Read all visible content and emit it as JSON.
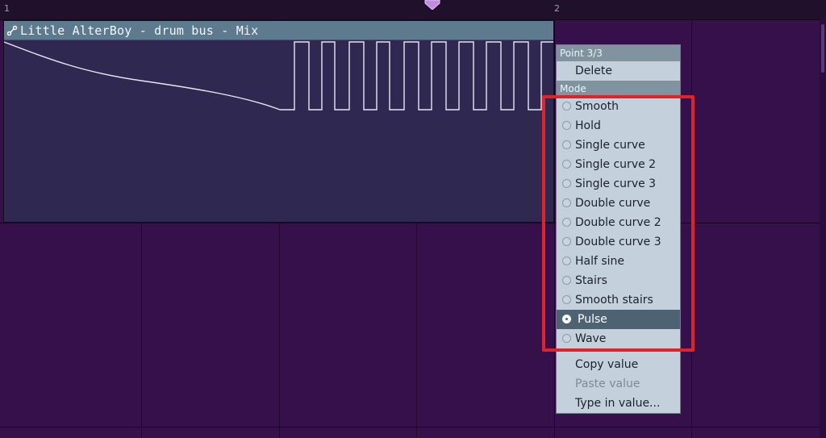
{
  "ruler": {
    "bar_1": "1",
    "bar_2": "2"
  },
  "clip": {
    "title": "Little AlterBoy - drum bus - Mix",
    "icon": "automation-link-icon"
  },
  "context_menu": {
    "point_header": "Point 3/3",
    "delete_label": "Delete",
    "mode_header": "Mode",
    "modes": [
      {
        "label": "Smooth",
        "selected": false
      },
      {
        "label": "Hold",
        "selected": false
      },
      {
        "label": "Single curve",
        "selected": false
      },
      {
        "label": "Single curve 2",
        "selected": false
      },
      {
        "label": "Single curve 3",
        "selected": false
      },
      {
        "label": "Double curve",
        "selected": false
      },
      {
        "label": "Double curve 2",
        "selected": false
      },
      {
        "label": "Double curve 3",
        "selected": false
      },
      {
        "label": "Half sine",
        "selected": false
      },
      {
        "label": "Stairs",
        "selected": false
      },
      {
        "label": "Smooth stairs",
        "selected": false
      },
      {
        "label": "Pulse",
        "selected": true
      },
      {
        "label": "Wave",
        "selected": false
      }
    ],
    "copy_value_label": "Copy value",
    "paste_value_label": "Paste value",
    "paste_value_enabled": false,
    "type_in_value_label": "Type in value..."
  },
  "colors": {
    "background": "#35104b",
    "clip_body": "#2f2850",
    "clip_header": "#5d7a8f",
    "menu_bg": "#c4d0dc",
    "menu_selected": "#4d6374",
    "highlight": "#e0232b",
    "curve": "#e8e6f2"
  }
}
